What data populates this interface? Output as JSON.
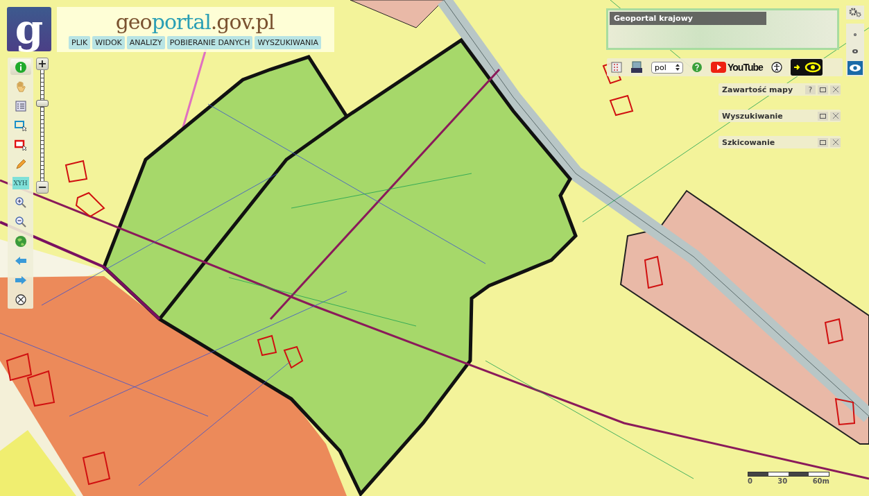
{
  "header": {
    "logo_letter": "g",
    "brand": [
      {
        "text": "geo",
        "color": "#7a5230"
      },
      {
        "text": "portal",
        "color": "#2a9fb5"
      },
      {
        "text": ".gov.pl",
        "color": "#7a5230"
      }
    ],
    "menu": [
      "PLIK",
      "WIDOK",
      "ANALIZY",
      "POBIERANIE DANYCH",
      "WYSZUKIWANIA"
    ]
  },
  "tools": [
    {
      "kind": "info",
      "selected": true
    },
    {
      "kind": "pan",
      "selected": false
    },
    {
      "kind": "legend",
      "selected": false
    },
    {
      "kind": "select-blue",
      "selected": false
    },
    {
      "kind": "select-red",
      "selected": false
    },
    {
      "kind": "pencil",
      "selected": false
    },
    {
      "kind": "xyh",
      "label": "XYH",
      "selected": false
    },
    {
      "kind": "zoom-in",
      "selected": false
    },
    {
      "kind": "zoom-out",
      "selected": false
    },
    {
      "kind": "globe",
      "selected": false
    },
    {
      "kind": "back",
      "selected": false
    },
    {
      "kind": "forward",
      "selected": false
    },
    {
      "kind": "clear",
      "selected": false
    }
  ],
  "zoom": {
    "plus": "+",
    "minus": "−",
    "level": 0.72
  },
  "overview": {
    "title": "Geoportal krajowy"
  },
  "top_toolbar": {
    "language": "pol",
    "video_label": "YouTube"
  },
  "panels": [
    {
      "title": "Zawartość mapy",
      "help": "?"
    },
    {
      "title": "Wyszukiwanie"
    },
    {
      "title": "Szkicowanie"
    }
  ],
  "view_modes": [
    {
      "kind": "small",
      "selected": false
    },
    {
      "kind": "medium",
      "selected": false
    },
    {
      "kind": "large",
      "selected": true
    }
  ],
  "scale_bar": {
    "labels": [
      "0",
      "30",
      "60m"
    ]
  }
}
